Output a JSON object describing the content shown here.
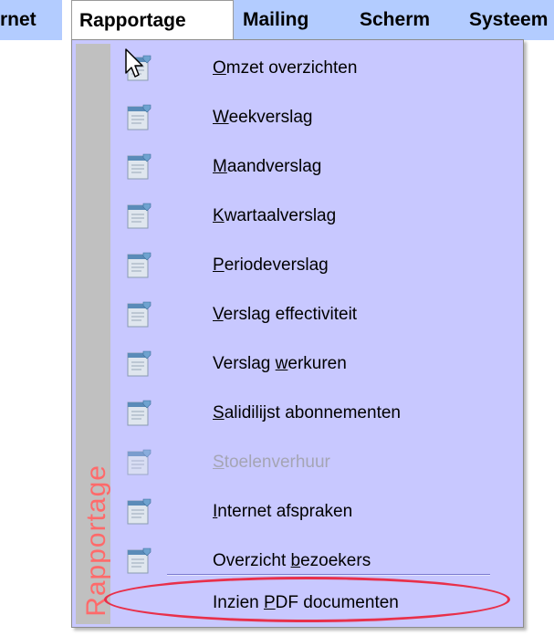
{
  "menubar": {
    "items": [
      {
        "label": "rnet"
      },
      {
        "label": "Rapportage"
      },
      {
        "label": "Mailing"
      },
      {
        "label": "Scherm"
      },
      {
        "label": "Systeem"
      }
    ]
  },
  "dropdown": {
    "sidebar_label": "Rapportage",
    "items": [
      {
        "pre": "",
        "accel": "O",
        "post": "mzet overzichten",
        "enabled": true
      },
      {
        "pre": "",
        "accel": "W",
        "post": "eekverslag",
        "enabled": true
      },
      {
        "pre": "",
        "accel": "M",
        "post": "aandverslag",
        "enabled": true
      },
      {
        "pre": "",
        "accel": "K",
        "post": "wartaalverslag",
        "enabled": true
      },
      {
        "pre": "",
        "accel": "P",
        "post": "eriodeverslag",
        "enabled": true
      },
      {
        "pre": "",
        "accel": "V",
        "post": "erslag effectiviteit",
        "enabled": true
      },
      {
        "pre": "Verslag ",
        "accel": "w",
        "post": "erkuren",
        "enabled": true
      },
      {
        "pre": "",
        "accel": "S",
        "post": "alidilijst abonnementen",
        "enabled": true
      },
      {
        "pre": "",
        "accel": "S",
        "post": "toelenverhuur",
        "enabled": false
      },
      {
        "pre": "",
        "accel": "I",
        "post": "nternet afspraken",
        "enabled": true
      },
      {
        "pre": "Overzicht ",
        "accel": "b",
        "post": "ezoekers",
        "enabled": true
      },
      {
        "pre": "Inzien ",
        "accel": "P",
        "post": "DF documenten",
        "enabled": true
      }
    ]
  },
  "colors": {
    "menu_background": "#c8c8ff",
    "menubar_highlight": "#b3ccff",
    "sidebar_text": "#ff6a6a",
    "annotation_ellipse": "#e8304a"
  },
  "icons": {
    "menu_item_icon": "report-document-icon",
    "cursor": "mouse-pointer-icon"
  }
}
